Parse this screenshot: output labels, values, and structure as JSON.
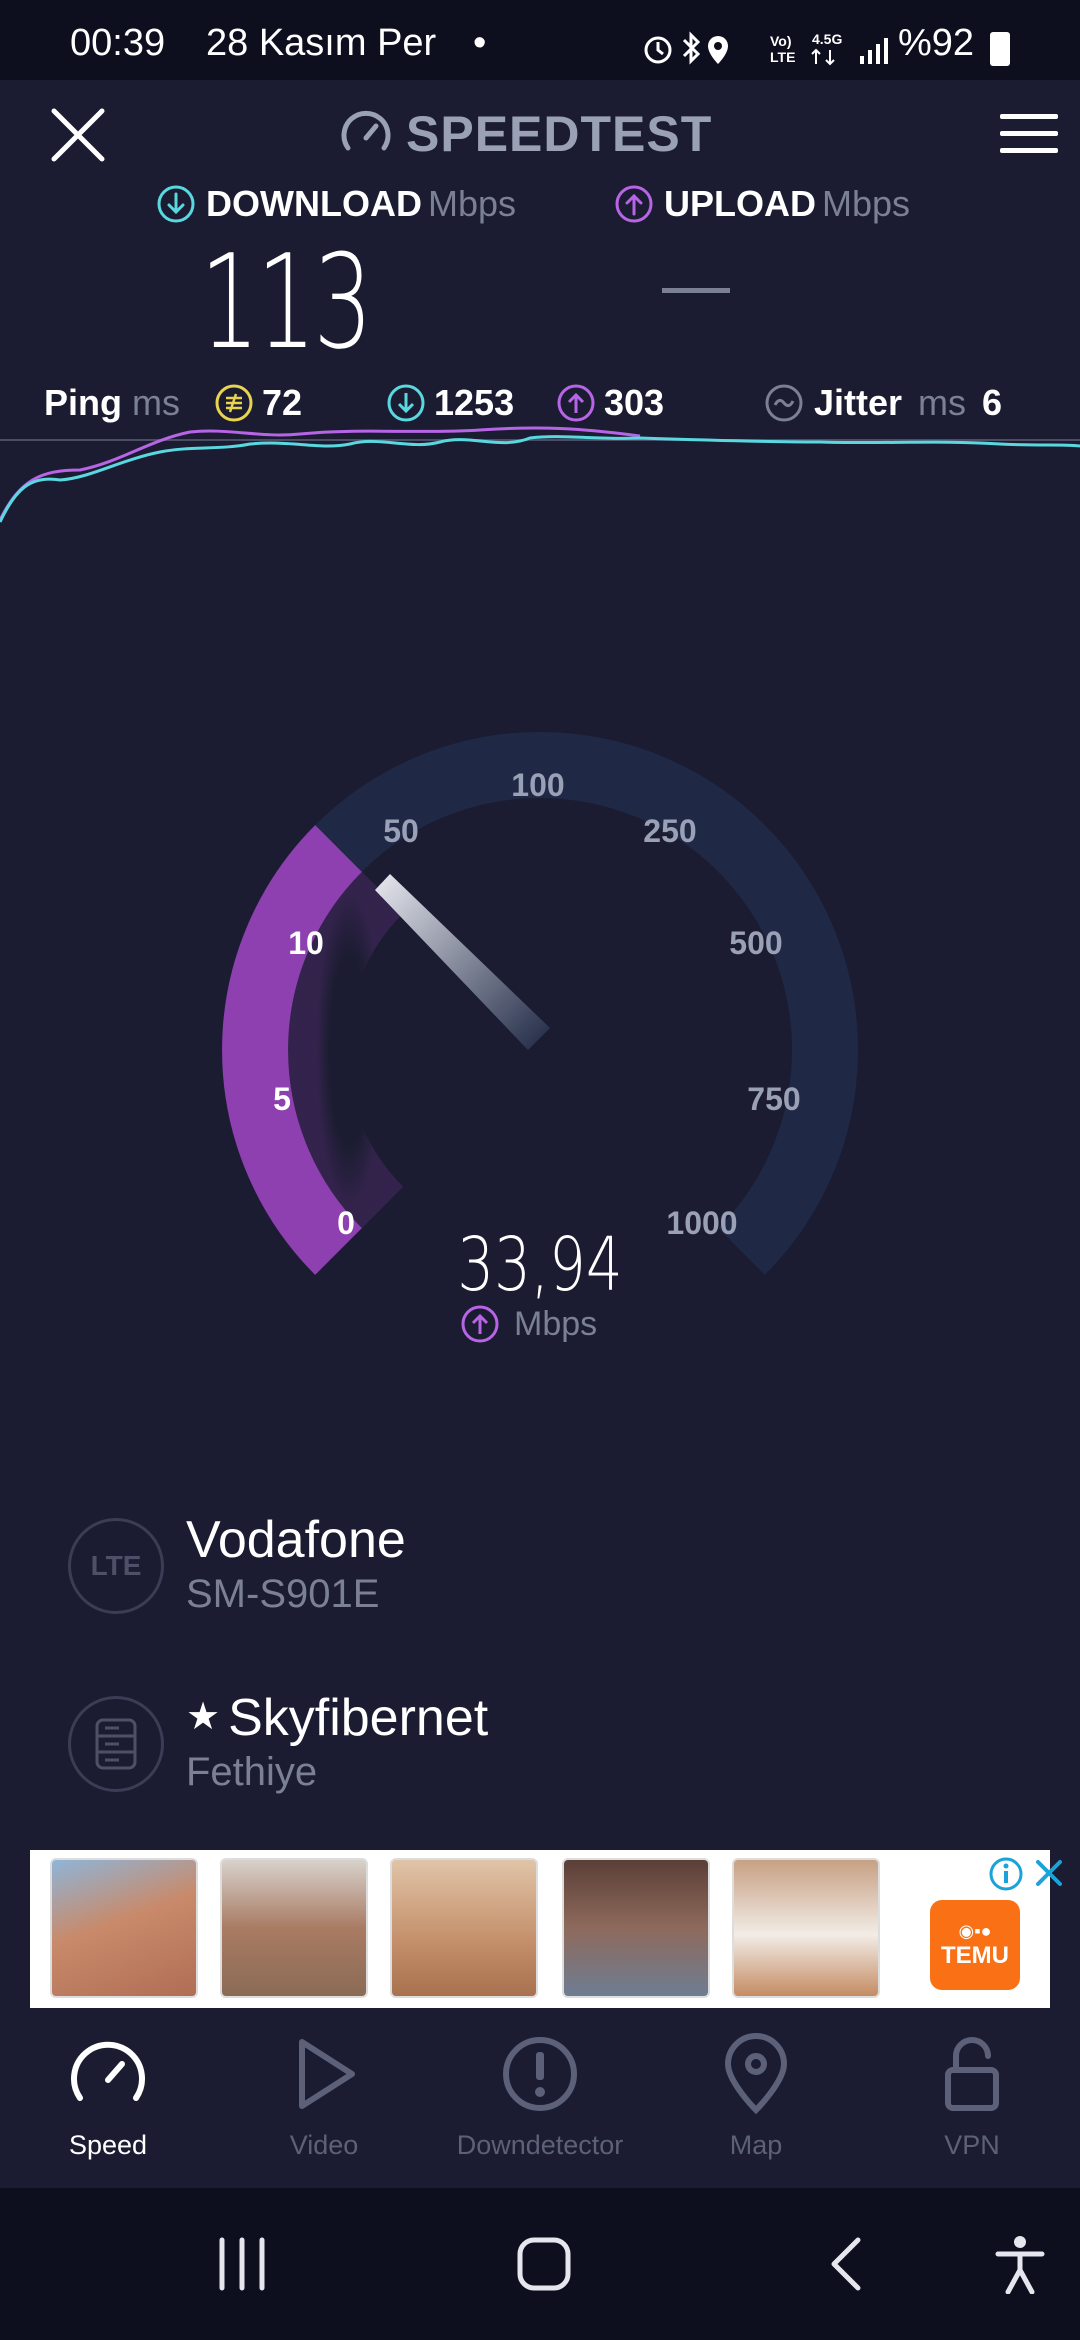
{
  "status_bar": {
    "time": "00:39",
    "date": "28 Kasım Per",
    "dot": "•",
    "network_label_1": "Vo)",
    "network_label_2": "LTE",
    "network_label_3": "4.5G",
    "battery_percent": "%92"
  },
  "header": {
    "title": "SPEEDTEST"
  },
  "download": {
    "label": "DOWNLOAD",
    "unit": "Mbps",
    "value": "113"
  },
  "upload": {
    "label": "UPLOAD",
    "unit": "Mbps",
    "value": "—"
  },
  "ping": {
    "label": "Ping",
    "unit": "ms",
    "idle": "72",
    "download": "1253",
    "upload": "303"
  },
  "jitter": {
    "label": "Jitter",
    "unit": "ms",
    "value": "6"
  },
  "gauge": {
    "ticks": [
      "0",
      "5",
      "10",
      "50",
      "100",
      "250",
      "500",
      "750",
      "1000"
    ],
    "current_value": "33,94",
    "unit": "Mbps",
    "colors": {
      "track": "#1f2844",
      "fill": "#8e3fb0",
      "needle": "#d6d8e3"
    }
  },
  "carrier": {
    "badge": "LTE",
    "name": "Vodafone",
    "device": "SM-S901E"
  },
  "server": {
    "star": "★",
    "name": "Skyfibernet",
    "location": "Fethiye"
  },
  "ad": {
    "brand_text": "TEMU",
    "brand_color": "#f97015"
  },
  "bottom_nav": [
    {
      "label": "Speed",
      "icon": "speedometer-icon",
      "active": true
    },
    {
      "label": "Video",
      "icon": "play-icon",
      "active": false
    },
    {
      "label": "Downdetector",
      "icon": "alert-icon",
      "active": false
    },
    {
      "label": "Map",
      "icon": "map-pin-icon",
      "active": false
    },
    {
      "label": "VPN",
      "icon": "lock-icon",
      "active": false
    }
  ],
  "colors": {
    "background": "#1b1c31",
    "download_accent": "#5ad8e0",
    "upload_accent": "#b765e6",
    "ping_accent": "#e8d44f",
    "muted_text": "#7b8095"
  }
}
